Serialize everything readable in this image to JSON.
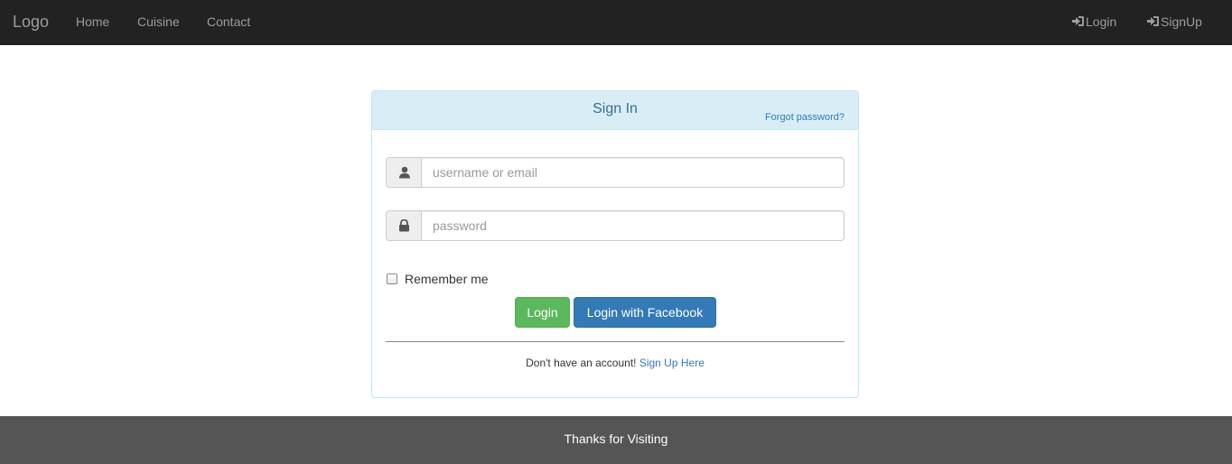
{
  "navbar": {
    "brand": "Logo",
    "links": [
      "Home",
      "Cuisine",
      "Contact"
    ],
    "login_label": "Login",
    "signup_label": "SignUp",
    "login_icon": "log-in-icon",
    "signup_icon": "log-in-icon"
  },
  "signin": {
    "title": "Sign In",
    "forgot_password": "Forgot password?",
    "username_icon": "user-icon",
    "username_placeholder": "username or email",
    "username_value": "",
    "password_icon": "lock-icon",
    "password_placeholder": "password",
    "password_value": "",
    "remember_label": "Remember me",
    "remember_checked": false,
    "login_button": "Login",
    "facebook_button": "Login with Facebook",
    "no_account_text": "Don't have an account!",
    "signup_link": "Sign Up Here"
  },
  "footer": {
    "text": "Thanks for Visiting"
  },
  "colors": {
    "navbar_bg": "#222222",
    "panel_heading_bg": "#d9edf7",
    "login_green": "#5cb85c",
    "facebook_blue": "#337ab7",
    "footer_bg": "#555555"
  }
}
